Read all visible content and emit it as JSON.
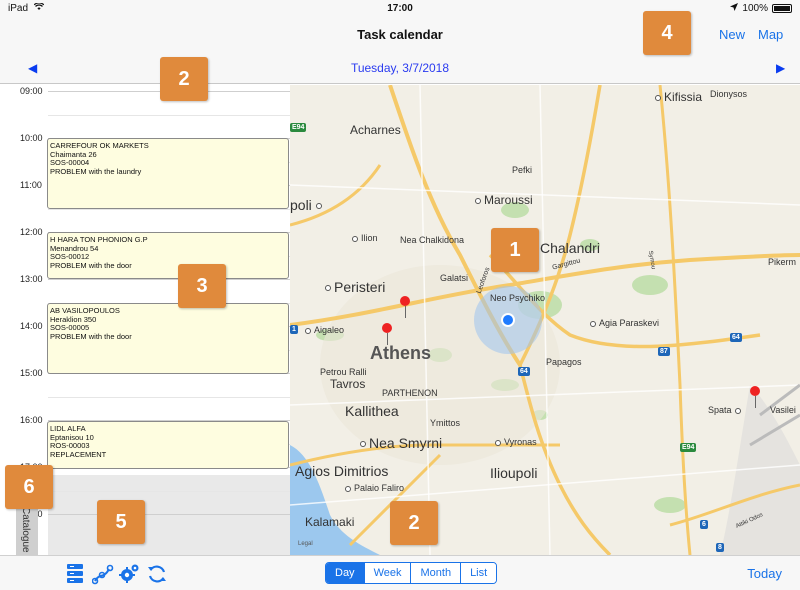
{
  "status": {
    "device": "iPad",
    "time": "17:00",
    "battery": "100%"
  },
  "nav": {
    "title": "Task calendar",
    "new_label": "New",
    "map_label": "Map"
  },
  "datebar": {
    "date": "Tuesday, 3/7/2018",
    "prev": "◀",
    "next": "▶"
  },
  "timeline": {
    "hours": [
      "09:00",
      "10:00",
      "11:00",
      "12:00",
      "13:00",
      "14:00",
      "15:00",
      "16:00",
      "17:00",
      "18:00"
    ],
    "tasks": [
      {
        "company": "CARREFOUR OK MARKETS",
        "address": "Chaimanta 26",
        "code": "SOS-00004",
        "issue": "PROBLEM with the laundry"
      },
      {
        "company": "H HARA TON PHONION G.P",
        "address": "Menandrou 54",
        "code": "SOS-00012",
        "issue": "PROBLEM with the door"
      },
      {
        "company": "AB VASILOPOULOS",
        "address": "Heraklion 350",
        "code": "SOS-00005",
        "issue": "PROBLEM with the door"
      },
      {
        "company": "LIDL ALFA",
        "address": "Eptanisou 10",
        "code": "ROS-00003",
        "issue": "REPLACEMENT"
      }
    ]
  },
  "catalogue": {
    "label": "Catalogue"
  },
  "map": {
    "labels": {
      "kifissia": "Kifissia",
      "dionysos": "Dionysos",
      "acharnes": "Acharnes",
      "pefki": "Pefki",
      "marousi": "Maroussi",
      "poli": "poli",
      "ilion": "Ilion",
      "nea_chalkidona": "Nea Chalkidona",
      "chalandri": "Chalandri",
      "pikermi": "Pikerm",
      "galatsi": "Galatsi",
      "peristeri": "Peristeri",
      "neo_psychiko": "Neo Psychiko",
      "aigaleo": "Aigaleo",
      "agia_paraskevi": "Agia Paraskevi",
      "athens": "Athens",
      "papagos": "Papagos",
      "petrou_rali": "Petrou Ralli",
      "tavros": "Tavros",
      "parthenon": "PARTHENON",
      "kallithea": "Kallithea",
      "ymittos": "Ymittos",
      "spata": "Spata",
      "vasileio": "Vasilei",
      "nea_smyrni": "Nea Smyrni",
      "vyronas": "Vyronas",
      "agios_dimitrios": "Agios Dimitrios",
      "ilioupoli": "Ilioupoli",
      "palaio_faliro": "Palaio Faliro",
      "kalamaki": "Kalamaki",
      "leoforos": "Leoforos",
      "legal": "Legal",
      "gargittou": "Gargittou",
      "attiki_odos": "Attiki Odos",
      "symou": "Symou"
    },
    "shields": {
      "e94_top": "E94",
      "e94_right": "E94",
      "r64_a": "64",
      "r64_b": "64",
      "r87": "87",
      "r6": "6",
      "r8": "8",
      "r1": "1"
    },
    "colors": {
      "pin": "#e22222",
      "location": "#1f7bff",
      "shield_blue": "#1e66b8",
      "shield_green": "#2b8a3e"
    }
  },
  "toolbar": {
    "segments": [
      "Day",
      "Week",
      "Month",
      "List"
    ],
    "active_segment": "Day",
    "today_label": "Today"
  },
  "callouts": {
    "c1": "1",
    "c2a": "2",
    "c2b": "2",
    "c3": "3",
    "c4": "4",
    "c5": "5",
    "c6": "6"
  }
}
